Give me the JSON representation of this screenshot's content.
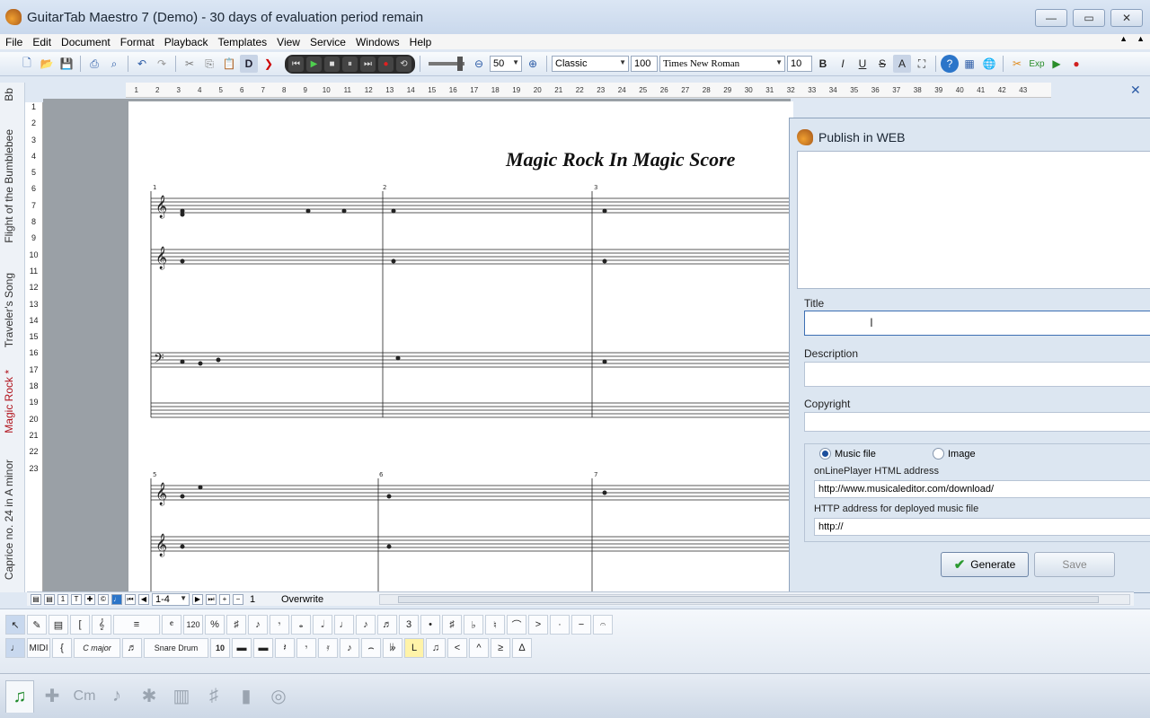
{
  "window": {
    "title": "GuitarTab Maestro 7 (Demo) - 30 days of evaluation period remain",
    "controls": [
      "—",
      "▭",
      "✕"
    ]
  },
  "menu": [
    "File",
    "Edit",
    "Document",
    "Format",
    "Playback",
    "Templates",
    "View",
    "Service",
    "Windows",
    "Help"
  ],
  "toolbar": {
    "zoom": "50",
    "style": "Classic",
    "size_percent": "100",
    "font": "Times New Roman",
    "font_size": "10"
  },
  "ruler": [
    "1",
    "2",
    "3",
    "4",
    "5",
    "6",
    "7",
    "8",
    "9",
    "10",
    "11",
    "12",
    "13",
    "14",
    "15",
    "16",
    "17",
    "18",
    "19",
    "20",
    "21",
    "22",
    "23",
    "24",
    "25",
    "26",
    "27",
    "28",
    "29",
    "30",
    "31",
    "32",
    "33",
    "34",
    "35",
    "36",
    "37",
    "38",
    "39",
    "40",
    "41",
    "42",
    "43"
  ],
  "doc_tabs": [
    {
      "label": "Caprice no. 24 in A minor",
      "active": false
    },
    {
      "label": "Magic Rock *",
      "active": true
    },
    {
      "label": "Traveler's Song",
      "active": false
    },
    {
      "label": "Flight of the Bumblebee",
      "active": false
    },
    {
      "label": "Bb",
      "active": false
    }
  ],
  "line_numbers": [
    "1",
    "2",
    "3",
    "4",
    "5",
    "6",
    "7",
    "8",
    "9",
    "10",
    "11",
    "12",
    "13",
    "14",
    "15",
    "16",
    "17",
    "18",
    "19",
    "20",
    "21",
    "22",
    "23"
  ],
  "score": {
    "title": "Magic Rock In Magic Score",
    "measure_numbers": [
      "1",
      "2",
      "3",
      "5",
      "6",
      "7"
    ]
  },
  "status": {
    "page_range": "1-4",
    "page": "1",
    "mode": "Overwrite"
  },
  "palette": {
    "key_label": "C major",
    "drum_label": "Snare Drum",
    "tempo_label": "120",
    "midi_label": "MIDI",
    "num_label": "10"
  },
  "publish": {
    "title": "Publish in WEB",
    "title_label": "Title",
    "title_value": "",
    "description_label": "Description",
    "description_value": "",
    "copyright_label": "Copyright",
    "copyright_value": "",
    "radio_music": "Music file",
    "radio_image": "Image",
    "player_label": "onLinePlayer HTML address",
    "player_value": "http://www.musicaleditor.com/download/",
    "http_label": "HTTP address for deployed music file",
    "http_value": "http://",
    "generate_label": "Generate",
    "save_label": "Save"
  },
  "colors": {
    "titlebar": "#dbe6f4",
    "panel": "#dce6f1",
    "active_tab": "#b0101a",
    "accent_green": "#2c9a30"
  }
}
